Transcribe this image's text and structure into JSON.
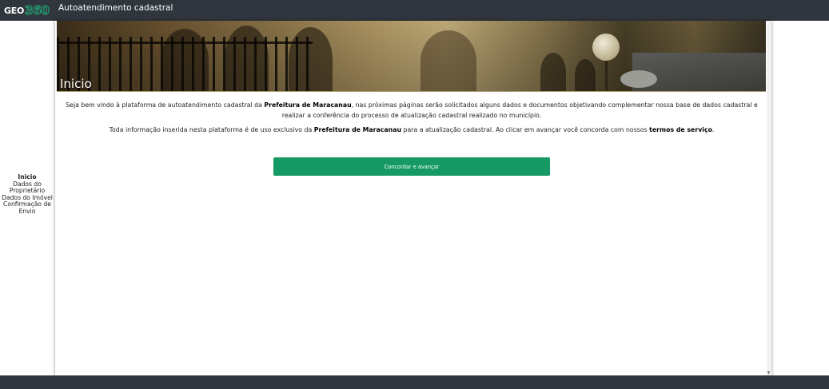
{
  "header": {
    "logo_text": "GEO",
    "logo_number": "360",
    "app_title": "Autoatendimento cadastral"
  },
  "sidebar": {
    "items": [
      {
        "label": "Inicio",
        "active": true
      },
      {
        "label": "Dados do Proprietário",
        "active": false
      },
      {
        "label": "Dados do Imóvel",
        "active": false
      },
      {
        "label": "Confirmação de Envio",
        "active": false
      }
    ]
  },
  "hero": {
    "title": "Inicio"
  },
  "content": {
    "p1_part1": "Seja bem vindo à plataforma de autoatendimento cadastral da ",
    "p1_bold": "Prefeitura de Maracanau",
    "p1_part2": ", nas próximas páginas serão solicitados alguns dados e documentos objetivando complementar nossa base de dados cadastral e realizar a conferência do processo de atualização cadastral realizado no município.",
    "p2_part1": "Toda informação inserida nesta plataforma é de uso exclusivo da ",
    "p2_bold": "Prefeitura de Maracanau",
    "p2_part2": " para a atualização cadastral. Ao clicar em avançar você concorda com nossos ",
    "p2_link": "termos de serviço",
    "p2_end": "."
  },
  "cta": {
    "label": "Concordar e avançar"
  },
  "colors": {
    "topbar": "#30363d",
    "accent": "#159a66",
    "logo_ring": "#1fb37a"
  }
}
